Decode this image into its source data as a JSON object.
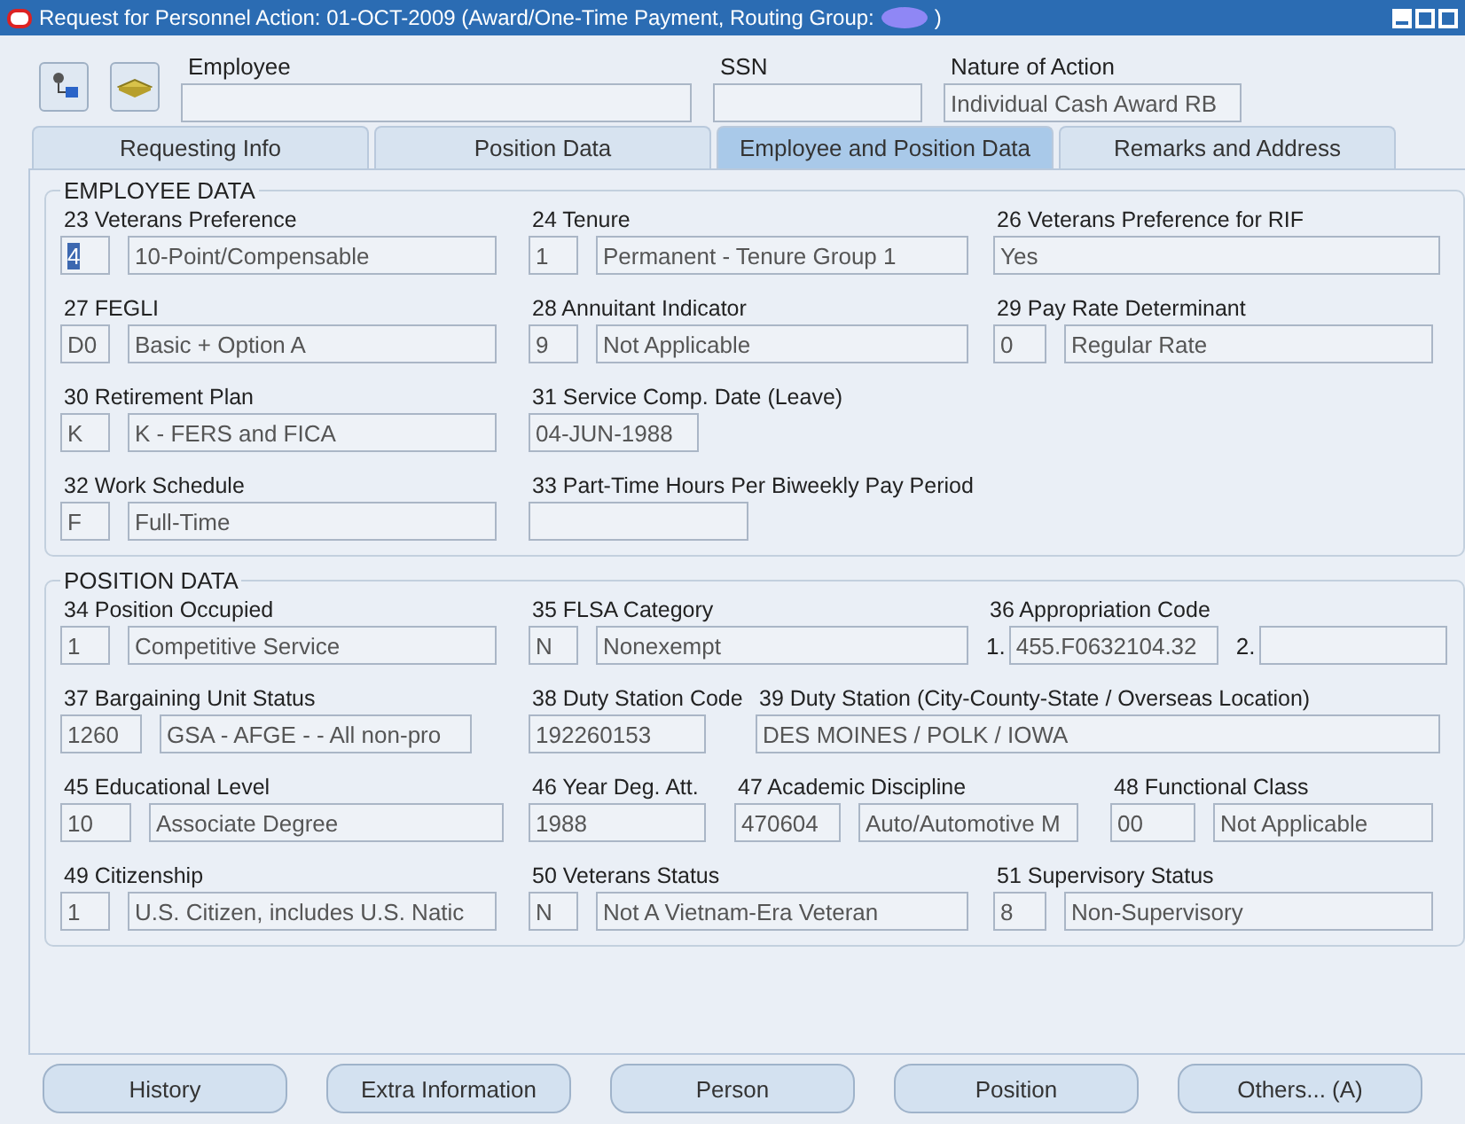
{
  "window": {
    "title": "Request for Personnel Action: 01-OCT-2009 (Award/One-Time Payment, Routing Group:",
    "title_end": ")"
  },
  "header": {
    "fields": [
      {
        "label": "Employee"
      },
      {
        "label": "SSN"
      },
      {
        "label": "Nature of Action",
        "value": "Individual Cash Award RB"
      }
    ]
  },
  "tabs": [
    {
      "label": "Requesting Info",
      "selected": false
    },
    {
      "label": "Position Data",
      "selected": false
    },
    {
      "label": "Employee and Position Data",
      "selected": true
    },
    {
      "label": "Remarks and Address",
      "selected": false
    }
  ],
  "sections": [
    {
      "title": "EMPLOYEE DATA",
      "rows": [
        [
          {
            "label": "23 Veterans Preference",
            "fields": [
              {
                "value": "4",
                "focused": true
              },
              {
                "value": "10-Point/Compensable",
                "focused": false
              }
            ]
          },
          {
            "label": "24 Tenure",
            "fields": [
              {
                "value": "1",
                "focused": false
              },
              {
                "value": "Permanent - Tenure Group 1",
                "focused": false
              }
            ]
          },
          {
            "label": "26 Veterans Preference for RIF",
            "fields": [
              {
                "value": "Yes",
                "focused": false
              }
            ]
          }
        ],
        [
          {
            "label": "27 FEGLI",
            "fields": [
              {
                "value": "D0",
                "focused": false
              },
              {
                "value": "Basic + Option A",
                "focused": false
              }
            ]
          },
          {
            "label": "28 Annuitant Indicator",
            "fields": [
              {
                "value": "9",
                "focused": false
              },
              {
                "value": "Not Applicable",
                "focused": false
              }
            ]
          },
          {
            "label": "29 Pay Rate Determinant",
            "fields": [
              {
                "value": "0",
                "focused": false
              },
              {
                "value": "Regular Rate",
                "focused": false
              }
            ]
          }
        ],
        [
          {
            "label": "30 Retirement Plan",
            "fields": [
              {
                "value": "K",
                "focused": false
              },
              {
                "value": "K - FERS and FICA",
                "focused": false
              }
            ]
          },
          {
            "label": "31 Service Comp. Date (Leave)",
            "fields": [
              {
                "value": "04-JUN-1988",
                "focused": false
              }
            ]
          }
        ],
        [
          {
            "label": "32 Work Schedule",
            "fields": [
              {
                "value": "F",
                "focused": false
              },
              {
                "value": "Full-Time",
                "focused": false
              }
            ]
          },
          {
            "label": "33 Part-Time Hours Per Biweekly Pay Period",
            "kind": "blank"
          }
        ]
      ]
    },
    {
      "title": "POSITION DATA",
      "rows": [
        [
          {
            "label": "34 Position Occupied",
            "fields": [
              {
                "value": "1",
                "focused": false
              },
              {
                "value": "Competitive Service",
                "focused": false
              }
            ]
          },
          {
            "label": "35 FLSA Category",
            "fields": [
              {
                "value": "N",
                "focused": false
              },
              {
                "value": "Nonexempt",
                "focused": false
              }
            ]
          },
          {
            "label": "36 Appropriation Code",
            "fields": [
              {
                "prefix": "1.",
                "value": "455.F0632104.32",
                "focused": false
              },
              {
                "prefix": "2."
              }
            ]
          }
        ],
        [
          {
            "label": "37 Bargaining Unit Status",
            "fields": [
              {
                "value": "1260",
                "focused": false
              },
              {
                "value": "GSA - AFGE - - All non-pro",
                "focused": false
              }
            ]
          },
          {
            "label": "38 Duty Station Code",
            "fields": [
              {
                "value": "192260153",
                "focused": false
              }
            ]
          },
          {
            "label": "39 Duty Station (City-County-State / Overseas Location)",
            "fields": [
              {
                "value": "DES MOINES / POLK / IOWA",
                "focused": false
              }
            ]
          }
        ],
        [
          {
            "label": "45 Educational Level",
            "fields": [
              {
                "value": "10",
                "focused": false
              },
              {
                "value": "Associate Degree",
                "focused": false
              }
            ]
          },
          {
            "label": "46 Year Deg. Att.",
            "fields": [
              {
                "value": "1988",
                "focused": false
              }
            ]
          },
          {
            "label": "47 Academic Discipline",
            "fields": [
              {
                "value": "470604",
                "focused": false
              },
              {
                "value": "Auto/Automotive M",
                "focused": false
              }
            ]
          },
          {
            "label": "48 Functional Class",
            "fields": [
              {
                "value": "00",
                "focused": false
              },
              {
                "value": "Not Applicable",
                "focused": false
              }
            ]
          }
        ],
        [
          {
            "label": "49 Citizenship",
            "fields": [
              {
                "value": "1",
                "focused": false
              },
              {
                "value": "U.S. Citizen, includes U.S. Natic",
                "focused": false
              }
            ]
          },
          {
            "label": "50 Veterans Status",
            "fields": [
              {
                "value": "N",
                "focused": false
              },
              {
                "value": "Not A Vietnam-Era Veteran",
                "focused": false
              }
            ]
          },
          {
            "label": "51 Supervisory Status",
            "fields": [
              {
                "value": "8",
                "focused": false
              },
              {
                "value": "Non-Supervisory",
                "focused": false
              }
            ]
          }
        ]
      ]
    }
  ],
  "buttons": [
    "History",
    "Extra Information",
    "Person",
    "Position",
    "Others... (A)"
  ]
}
